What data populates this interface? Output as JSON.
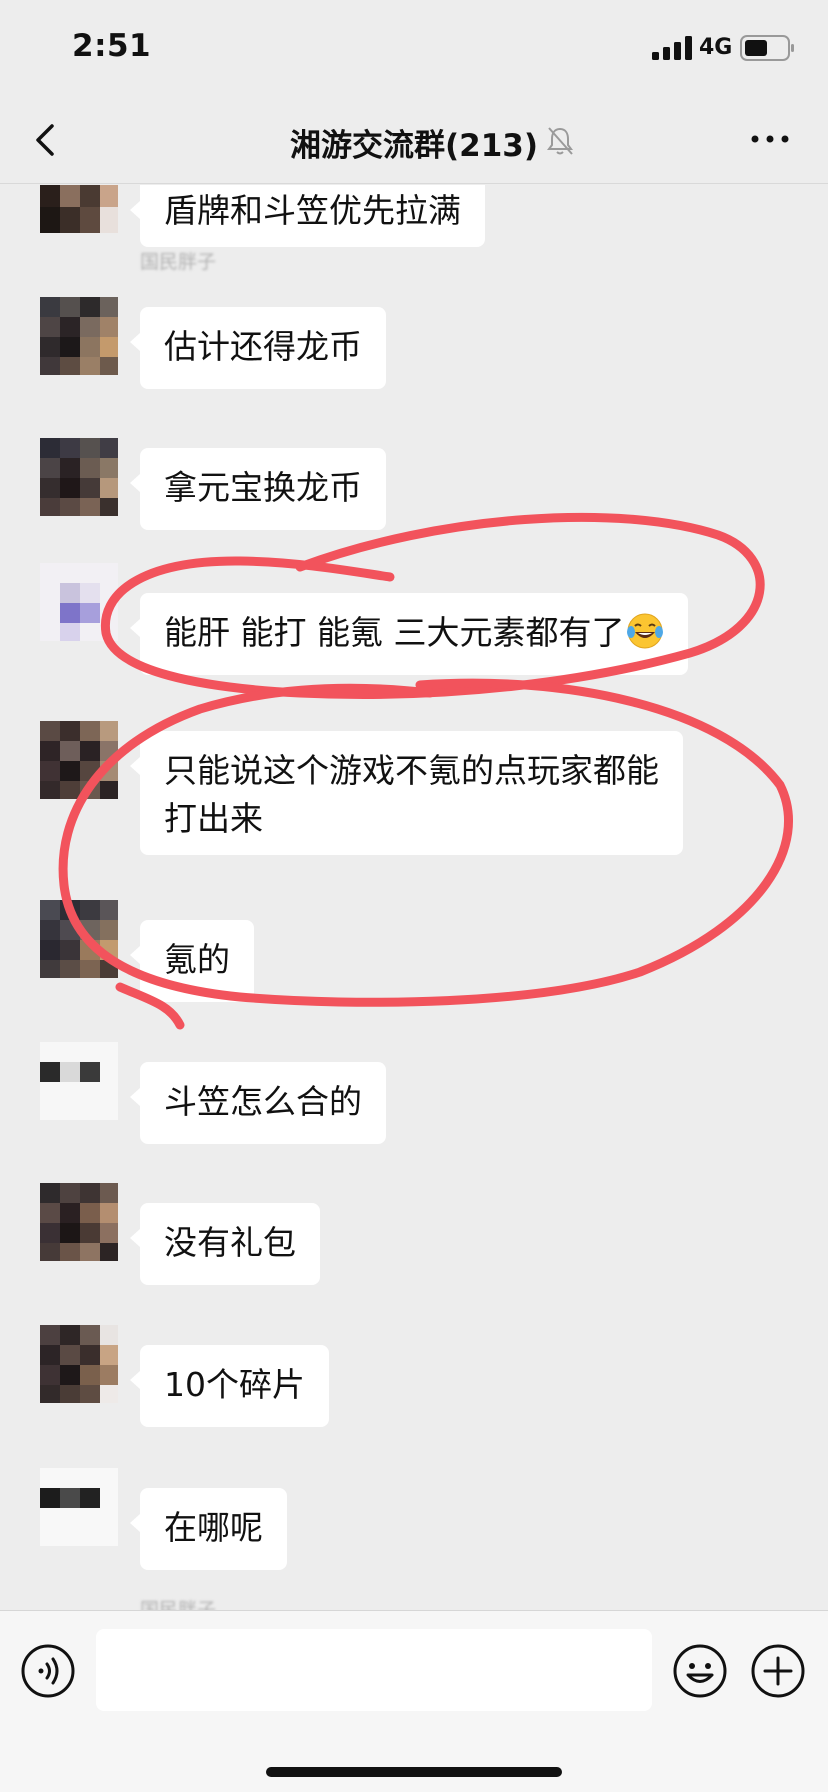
{
  "status_bar": {
    "time": "2:51",
    "network": "4G"
  },
  "header": {
    "title": "湘游交流群(213)"
  },
  "messages": [
    {
      "sender": "",
      "text": "盾牌和斗笠优先拉满"
    },
    {
      "sender": "国民胖子",
      "text": "估计还得龙币"
    },
    {
      "sender": "",
      "text": "拿元宝换龙币"
    },
    {
      "sender": "",
      "text": "能肝 能打 能氪 三大元素都有了",
      "emoji": "tears-of-joy-emoji"
    },
    {
      "sender": "",
      "text": "只能说这个游戏不氪的点玩家都能",
      "text2": "打出来"
    },
    {
      "sender": "",
      "text": "氪的"
    },
    {
      "sender": "",
      "text": "斗笠怎么合的"
    },
    {
      "sender": "",
      "text": "没有礼包"
    },
    {
      "sender": "",
      "text": "10个碎片"
    },
    {
      "sender": "",
      "text": "在哪呢"
    },
    {
      "sender": "国民胖子",
      "text": ""
    }
  ],
  "input": {
    "placeholder": ""
  },
  "colors": {
    "background": "#ededed",
    "bubble": "#ffffff",
    "annotation": "#f2535c",
    "input_bar": "#f6f6f6"
  }
}
